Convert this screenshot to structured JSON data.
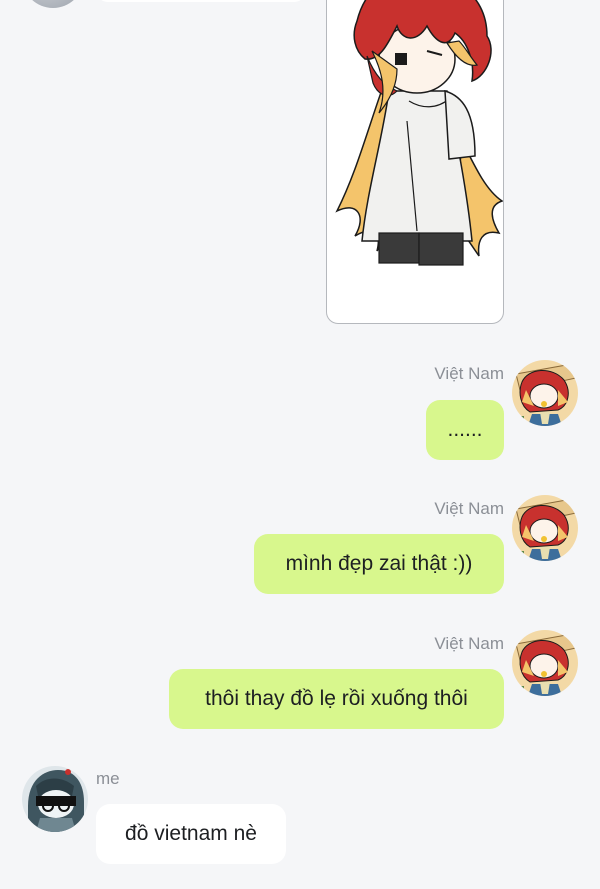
{
  "messages": [
    {
      "sender": "Việt Nam",
      "text": "......",
      "direction": "outgoing"
    },
    {
      "sender": "Việt Nam",
      "text": "mình đẹp zai thật :))",
      "direction": "outgoing"
    },
    {
      "sender": "Việt Nam",
      "text": "thôi thay đồ lẹ rồi xuống thôi",
      "direction": "outgoing"
    },
    {
      "sender": "me",
      "text": "đồ vietnam nè",
      "direction": "incoming"
    }
  ],
  "image_message": {
    "icon": "character-drawing-image"
  },
  "colors": {
    "background": "#f5f6f8",
    "outgoing_bubble": "#d8f78d",
    "incoming_bubble": "#ffffff",
    "sender_name": "#8b8f96"
  }
}
